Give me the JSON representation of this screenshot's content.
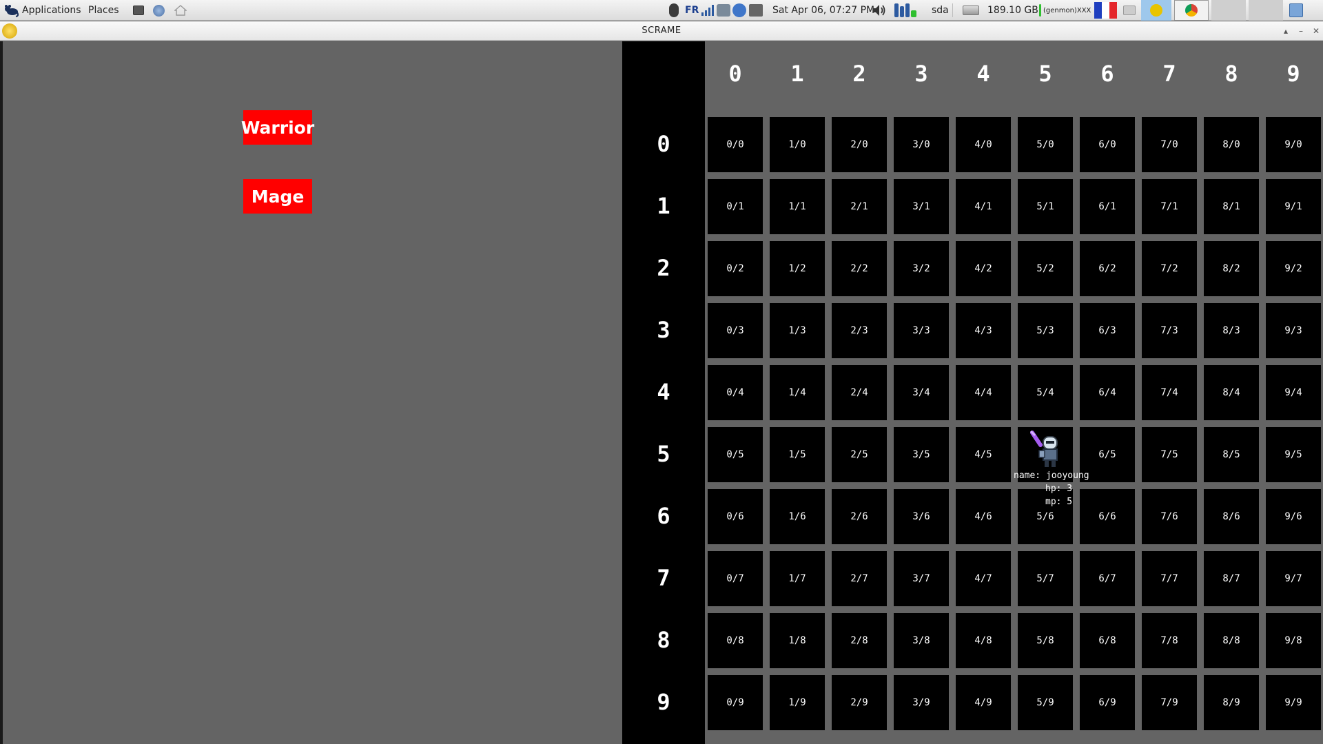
{
  "panel": {
    "applications_label": "Applications",
    "places_label": "Places",
    "keyboard_layout": "FR",
    "datetime": "Sat Apr 06, 07:27 PM",
    "disk_name": "sda",
    "disk_free": "189.10 GB",
    "genmon_label": "(genmon)XXX"
  },
  "window": {
    "title": "SCRAME"
  },
  "class_select": {
    "warrior_label": "Warrior",
    "mage_label": "Mage"
  },
  "board": {
    "column_headers": [
      "0",
      "1",
      "2",
      "3",
      "4",
      "5",
      "6",
      "7",
      "8",
      "9"
    ],
    "row_headers": [
      "0",
      "1",
      "2",
      "3",
      "4",
      "5",
      "6",
      "7",
      "8",
      "9"
    ],
    "cells": [
      [
        "0/0",
        "1/0",
        "2/0",
        "3/0",
        "4/0",
        "5/0",
        "6/0",
        "7/0",
        "8/0",
        "9/0"
      ],
      [
        "0/1",
        "1/1",
        "2/1",
        "3/1",
        "4/1",
        "5/1",
        "6/1",
        "7/1",
        "8/1",
        "9/1"
      ],
      [
        "0/2",
        "1/2",
        "2/2",
        "3/2",
        "4/2",
        "5/2",
        "6/2",
        "7/2",
        "8/2",
        "9/2"
      ],
      [
        "0/3",
        "1/3",
        "2/3",
        "3/3",
        "4/3",
        "5/3",
        "6/3",
        "7/3",
        "8/3",
        "9/3"
      ],
      [
        "0/4",
        "1/4",
        "2/4",
        "3/4",
        "4/4",
        "5/4",
        "6/4",
        "7/4",
        "8/4",
        "9/4"
      ],
      [
        "0/5",
        "1/5",
        "2/5",
        "3/5",
        "4/5",
        "",
        "6/5",
        "7/5",
        "8/5",
        "9/5"
      ],
      [
        "0/6",
        "1/6",
        "2/6",
        "3/6",
        "4/6",
        "5/6",
        "6/6",
        "7/6",
        "8/6",
        "9/6"
      ],
      [
        "0/7",
        "1/7",
        "2/7",
        "3/7",
        "4/7",
        "5/7",
        "6/7",
        "7/7",
        "8/7",
        "9/7"
      ],
      [
        "0/8",
        "1/8",
        "2/8",
        "3/8",
        "4/8",
        "5/8",
        "6/8",
        "7/8",
        "8/8",
        "9/8"
      ],
      [
        "0/9",
        "1/9",
        "2/9",
        "3/9",
        "4/9",
        "5/9",
        "6/9",
        "7/9",
        "8/9",
        "9/9"
      ]
    ]
  },
  "player": {
    "name_line": "name: jooyoung",
    "hp_line": "hp: 3",
    "mp_line": "mp: 5",
    "sprite_icon": "knight-sprite-icon"
  },
  "colors": {
    "class_button": "#ff0000",
    "background": "#646464",
    "cell": "#000000"
  }
}
